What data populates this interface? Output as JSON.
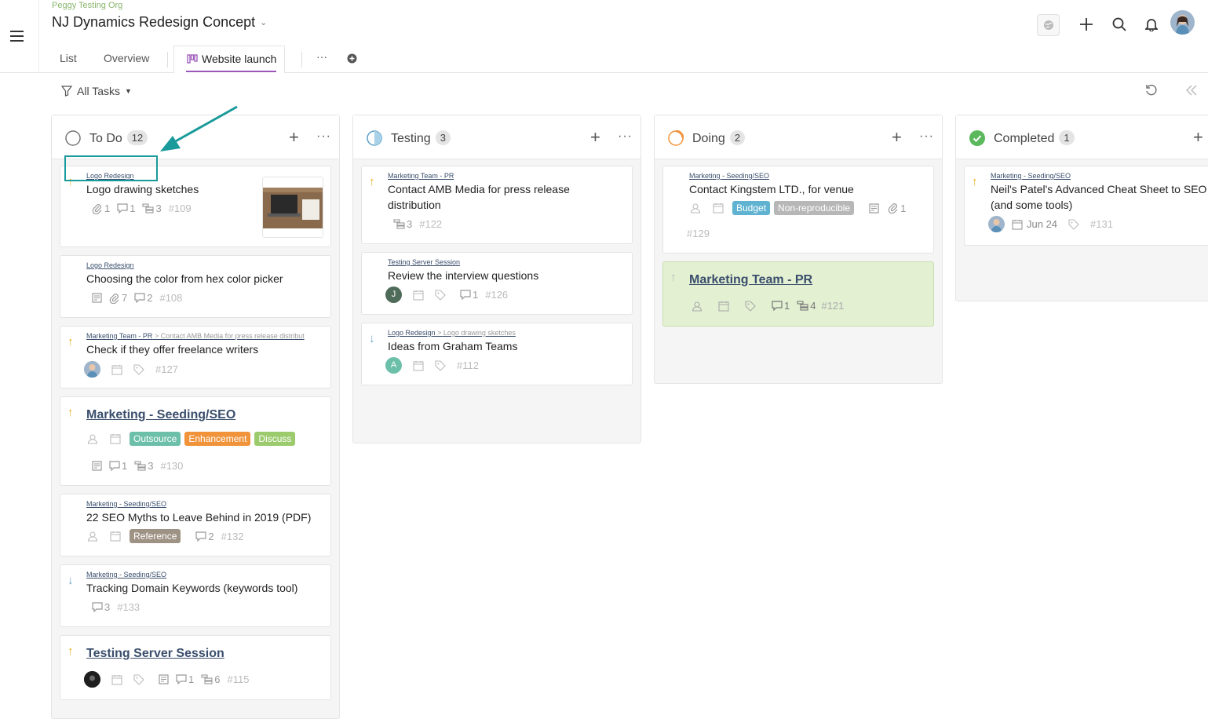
{
  "header": {
    "org": "Peggy Testing Org",
    "title": "NJ Dynamics Redesign Concept",
    "tabs": [
      {
        "label": "List"
      },
      {
        "label": "Overview"
      },
      {
        "label": "Website launch",
        "active": true
      }
    ],
    "more_label": "···"
  },
  "filter": {
    "label": "All Tasks"
  },
  "colors": {
    "accent": "#9c56b8",
    "link": "#3a4e6c",
    "highlight_box": "#1a9a9a",
    "priority_up": "#e9b21c",
    "priority_down": "#6ba4c7"
  },
  "columns": [
    {
      "name": "To Do",
      "count": "12",
      "status_icon": "circle-empty-icon",
      "cards": [
        {
          "priority": "up",
          "parent": "Logo Redesign",
          "title": "Logo drawing sketches",
          "attachments": "1",
          "comments": "1",
          "subtasks": "3",
          "id": "#109",
          "thumbnail": "laptop-photo"
        },
        {
          "priority": "none",
          "parent": "Logo Redesign",
          "title": "Choosing the color from hex color picker",
          "attachments": "7",
          "comments": "2",
          "id": "#108"
        },
        {
          "priority": "up",
          "parent": "Marketing Team - PR",
          "crumb": " > Contact AMB Media for press release distribut",
          "title": "Check if they offer freelance writers",
          "id": "#127"
        },
        {
          "priority": "up",
          "title": "Marketing - Seeding/SEO",
          "tags": [
            {
              "label": "Outsource",
              "color": "#6cbfa9"
            },
            {
              "label": "Enhancement",
              "color": "#f0933a"
            },
            {
              "label": "Discuss",
              "color": "#9ccb6e"
            }
          ],
          "comments": "1",
          "subtasks": "3",
          "id": "#130"
        },
        {
          "priority": "none",
          "parent": "Marketing - Seeding/SEO",
          "title": "22 SEO Myths to Leave Behind in 2019 (PDF)",
          "tags": [
            {
              "label": "Reference",
              "color": "#9e9284"
            }
          ],
          "comments": "2",
          "id": "#132"
        },
        {
          "priority": "down",
          "parent": "Marketing - Seeding/SEO",
          "title": "Tracking Domain Keywords (keywords tool)",
          "comments": "3",
          "id": "#133"
        },
        {
          "priority": "up",
          "title": "Testing Server Session",
          "comments": "1",
          "subtasks": "6",
          "id": "#115"
        }
      ]
    },
    {
      "name": "Testing",
      "count": "3",
      "status_icon": "circle-half-icon",
      "cards": [
        {
          "priority": "up",
          "parent": "Marketing Team - PR",
          "title": "Contact AMB Media for press release distribution",
          "subtasks": "3",
          "id": "#122"
        },
        {
          "priority": "none",
          "parent": "Testing Server Session",
          "title": "Review the interview questions",
          "assignee": "J",
          "comments": "1",
          "id": "#126"
        },
        {
          "priority": "down",
          "parent": "Logo Redesign",
          "crumb": " > Logo drawing sketches",
          "title": "Ideas from Graham Teams",
          "assignee": "A",
          "id": "#112"
        }
      ]
    },
    {
      "name": "Doing",
      "count": "2",
      "status_icon": "circle-progress-icon",
      "cards": [
        {
          "priority": "none",
          "parent": "Marketing - Seeding/SEO",
          "title": "Contact Kingstem LTD., for venue",
          "tags": [
            {
              "label": "Budget",
              "color": "#5fb3d1"
            },
            {
              "label": "Non-reproducible",
              "color": "#b7b7b7"
            }
          ],
          "attachments": "1",
          "id": "#129"
        },
        {
          "priority": "faint",
          "title": "Marketing Team - PR",
          "comments": "1",
          "subtasks": "4",
          "id": "#121"
        }
      ]
    },
    {
      "name": "Completed",
      "count": "1",
      "status_icon": "check-circle-icon",
      "cards": [
        {
          "priority": "up",
          "parent": "Marketing - Seeding/SEO",
          "title": "Neil's Patel's Advanced Cheat Sheet to SEO (and some tools)",
          "date": "Jun 24",
          "id": "#131"
        }
      ]
    }
  ]
}
